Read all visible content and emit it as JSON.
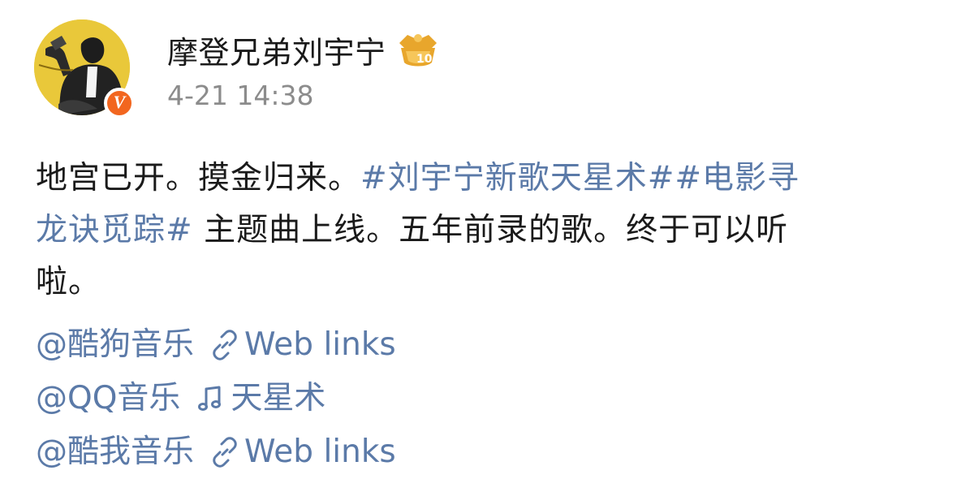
{
  "post": {
    "author": "摩登兄弟刘宇宁",
    "vip_level": "10",
    "verified_mark": "V",
    "timestamp": "4-21 14:38"
  },
  "content": {
    "line1_text": "地宫已开。摸金归来。",
    "hashtag1": "#刘宇宁新歌天星术#",
    "hashtag2_part1": "#电影寻",
    "hashtag2_part2": "龙诀觅踪#",
    "line2_text": " 主题曲上线。五年前录的歌。终于可以听",
    "line3_text": "啦。"
  },
  "links": [
    {
      "mention": "@酷狗音乐",
      "icon": "link-icon",
      "label": "Web links"
    },
    {
      "mention": "@QQ音乐",
      "icon": "music-note-icon",
      "label": "天星术"
    },
    {
      "mention": "@酷我音乐",
      "icon": "link-icon",
      "label": "Web links"
    }
  ],
  "colors": {
    "link": "#5b7aa8",
    "text": "#1a1a1a",
    "timestamp": "#8c8c8c",
    "verified": "#f2661f",
    "vip_gold": "#e8a62c"
  }
}
